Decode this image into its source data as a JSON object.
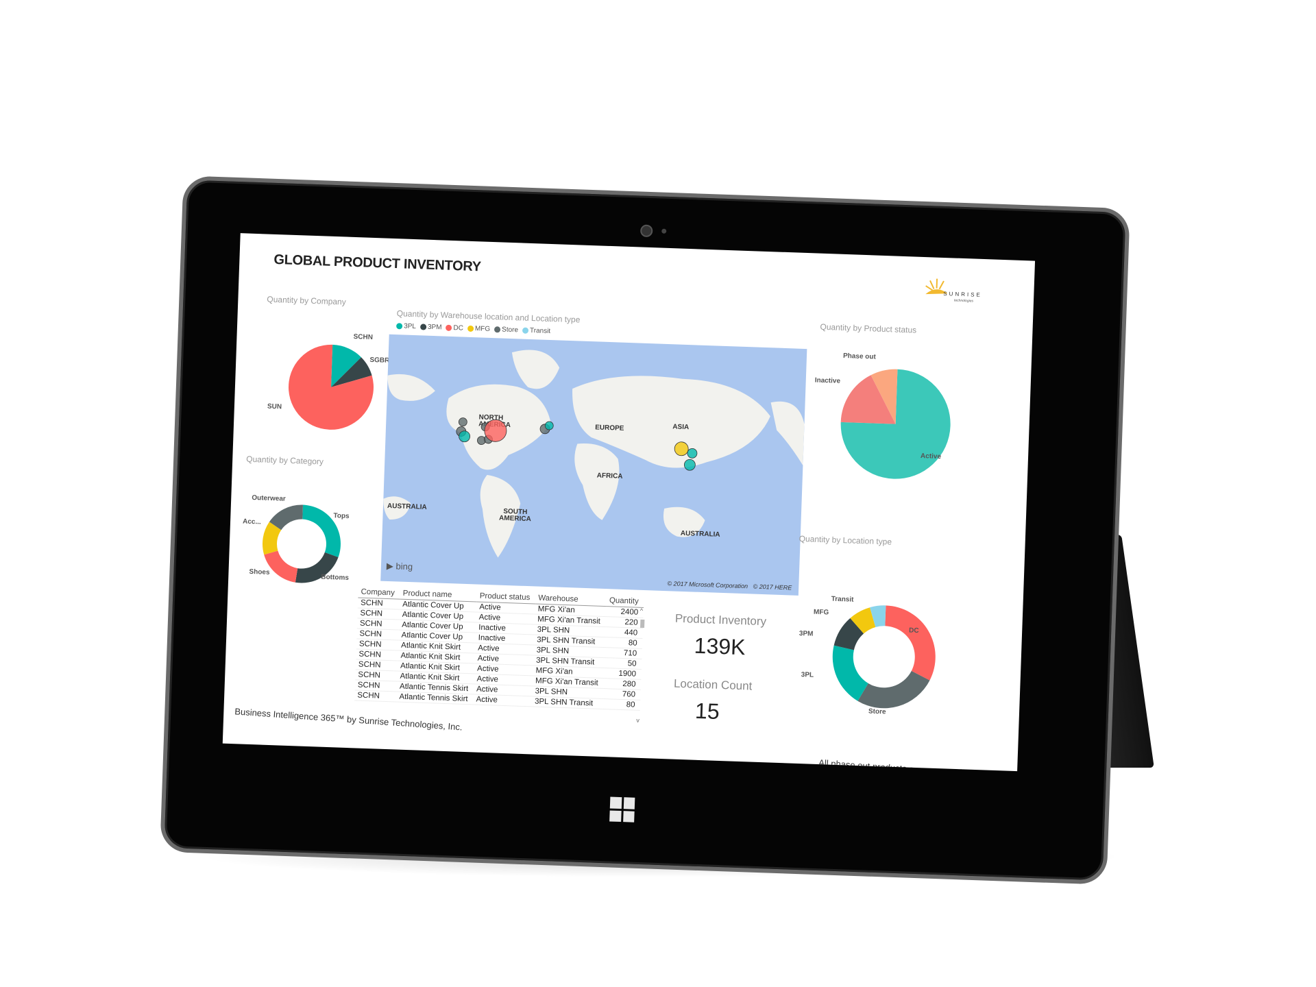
{
  "dashboard": {
    "title": "GLOBAL PRODUCT INVENTORY",
    "logo_text": "SUNRISE technologies",
    "footer": "Business Intelligence 365™ by Sunrise Technologies, Inc.",
    "note": "All phase out products are accessories"
  },
  "colors": {
    "teal": "#01B8AA",
    "dark": "#374649",
    "red": "#FD625E",
    "yellow": "#F2C80F",
    "gray": "#5F6B6D",
    "lightblue": "#8AD4EB",
    "salmon": "#FE9666",
    "map_water": "#AAC6EF",
    "map_land": "#F2F2EE"
  },
  "company_chart": {
    "title": "Quantity by Company",
    "type": "pie",
    "slices": [
      {
        "label": "SCHN",
        "value": 12,
        "color": "#01B8AA"
      },
      {
        "label": "SGBR",
        "value": 8,
        "color": "#374649"
      },
      {
        "label": "SUN",
        "value": 80,
        "color": "#FD625E"
      }
    ]
  },
  "category_chart": {
    "title": "Quantity by Category",
    "type": "donut",
    "slices": [
      {
        "label": "Tops",
        "value": 30,
        "color": "#01B8AA"
      },
      {
        "label": "Bottoms",
        "value": 22,
        "color": "#374649"
      },
      {
        "label": "Shoes",
        "value": 18,
        "color": "#FD625E"
      },
      {
        "label": "Acc...",
        "value": 14,
        "color": "#F2C80F"
      },
      {
        "label": "Outerwear",
        "value": 16,
        "color": "#5F6B6D"
      }
    ]
  },
  "status_chart": {
    "title": "Quantity by Product status",
    "type": "pie",
    "slices": [
      {
        "label": "Active",
        "value": 75,
        "color": "#3CC8B9"
      },
      {
        "label": "Inactive",
        "value": 17,
        "color": "#F47F7C"
      },
      {
        "label": "Phase out",
        "value": 8,
        "color": "#FBA77F"
      }
    ]
  },
  "location_chart": {
    "title": "Quantity by Location type",
    "type": "donut",
    "slices": [
      {
        "label": "DC",
        "value": 32,
        "color": "#FD625E"
      },
      {
        "label": "Store",
        "value": 26,
        "color": "#5F6B6D"
      },
      {
        "label": "3PL",
        "value": 20,
        "color": "#01B8AA"
      },
      {
        "label": "3PM",
        "value": 10,
        "color": "#374649"
      },
      {
        "label": "MFG",
        "value": 7,
        "color": "#F2C80F"
      },
      {
        "label": "Transit",
        "value": 5,
        "color": "#8AD4EB"
      }
    ]
  },
  "map": {
    "title": "Quantity by Warehouse location and Location type",
    "legend": [
      {
        "label": "3PL",
        "color": "#01B8AA"
      },
      {
        "label": "3PM",
        "color": "#374649"
      },
      {
        "label": "DC",
        "color": "#FD625E"
      },
      {
        "label": "MFG",
        "color": "#F2C80F"
      },
      {
        "label": "Store",
        "color": "#5F6B6D"
      },
      {
        "label": "Transit",
        "color": "#8AD4EB"
      }
    ],
    "region_labels": {
      "north_america": "NORTH AMERICA",
      "europe": "EUROPE",
      "asia": "ASIA",
      "africa": "AFRICA",
      "south_america": "SOUTH AMERICA",
      "australia_west": "AUSTRALIA",
      "australia": "AUSTRALIA"
    },
    "provider": "bing",
    "copyright_ms": "© 2017 Microsoft Corporation",
    "copyright_here": "© 2017 HERE"
  },
  "table": {
    "columns": [
      "Company",
      "Product name",
      "Product status",
      "Warehouse",
      "Quantity"
    ],
    "rows": [
      [
        "SCHN",
        "Atlantic Cover Up",
        "Active",
        "MFG Xi'an",
        "2400"
      ],
      [
        "SCHN",
        "Atlantic Cover Up",
        "Active",
        "MFG Xi'an Transit",
        "220"
      ],
      [
        "SCHN",
        "Atlantic Cover Up",
        "Inactive",
        "3PL SHN",
        "440"
      ],
      [
        "SCHN",
        "Atlantic Cover Up",
        "Inactive",
        "3PL SHN Transit",
        "80"
      ],
      [
        "SCHN",
        "Atlantic Knit Skirt",
        "Active",
        "3PL SHN",
        "710"
      ],
      [
        "SCHN",
        "Atlantic Knit Skirt",
        "Active",
        "3PL SHN Transit",
        "50"
      ],
      [
        "SCHN",
        "Atlantic Knit Skirt",
        "Active",
        "MFG Xi'an",
        "1900"
      ],
      [
        "SCHN",
        "Atlantic Knit Skirt",
        "Active",
        "MFG Xi'an Transit",
        "280"
      ],
      [
        "SCHN",
        "Atlantic Tennis Skirt",
        "Active",
        "3PL SHN",
        "760"
      ],
      [
        "SCHN",
        "Atlantic Tennis Skirt",
        "Active",
        "3PL SHN Transit",
        "80"
      ]
    ]
  },
  "kpis": [
    {
      "label": "Product Inventory",
      "value": "139K"
    },
    {
      "label": "Location Count",
      "value": "15"
    }
  ]
}
